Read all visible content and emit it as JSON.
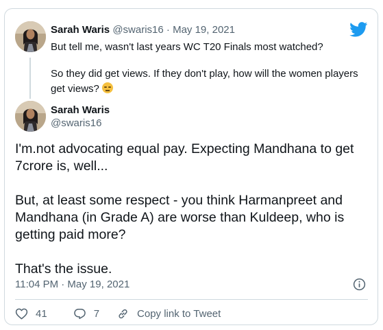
{
  "parent": {
    "name": "Sarah Waris",
    "handle_date": "@swaris16 · May 19, 2021",
    "line1": "But tell me, wasn't last years WC T20 Finals most watched?",
    "line2": "So they did get views. If they don't play, how will the women players get views?",
    "emoji": "😒"
  },
  "main": {
    "name": "Sarah Waris",
    "handle": "@swaris16",
    "paragraphs": [
      "I'm.not advocating equal pay. Expecting Mandhana to get 7crore is, well...",
      "But, at least some respect - you think Harmanpreet and Mandhana (in Grade A) are worse than Kuldeep, who is getting paid more?",
      "That's the issue."
    ],
    "timestamp": "11:04 PM · May 19, 2021"
  },
  "actions": {
    "likes": "41",
    "replies": "7",
    "copy_link": "Copy link to Tweet"
  },
  "colors": {
    "brand": "#1d9bf0",
    "muted": "#536471",
    "border": "#cfd9de"
  },
  "icons": [
    "twitter-logo-icon",
    "info-icon",
    "heart-icon",
    "reply-icon",
    "link-icon"
  ]
}
